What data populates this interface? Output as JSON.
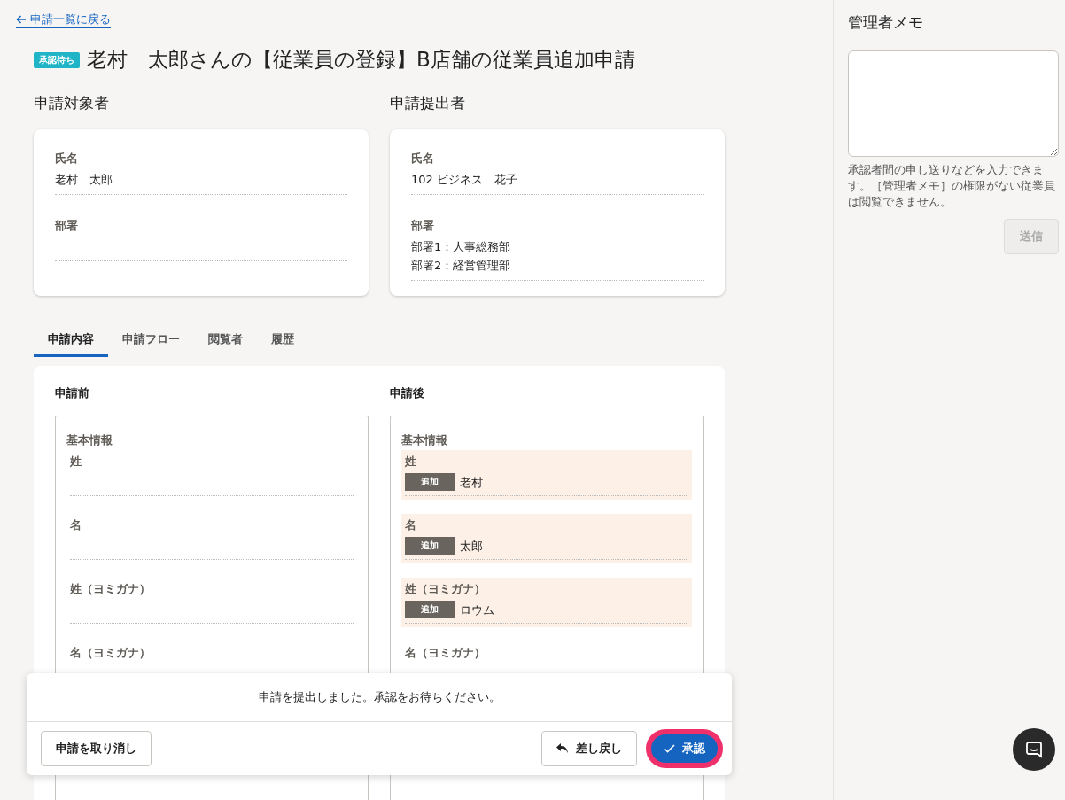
{
  "back_link": "申請一覧に戻る",
  "status_badge": "承認待ち",
  "title": "老村　太郎さんの【従業員の登録】B店舗の従業員追加申請",
  "people": [
    {
      "heading": "申請対象者",
      "fields": [
        {
          "label": "氏名",
          "lines": [
            "老村　太郎"
          ]
        },
        {
          "label": "部署"
        }
      ]
    },
    {
      "heading": "申請提出者",
      "fields": [
        {
          "label": "氏名",
          "lines": [
            "102 ビジネス　花子"
          ]
        },
        {
          "label": "部署",
          "lines": [
            "部署1：人事総務部",
            "部署2：経営管理部"
          ]
        }
      ]
    }
  ],
  "tabs": [
    {
      "label": "申請内容",
      "selected": true
    },
    {
      "label": "申請フロー",
      "selected": false
    },
    {
      "label": "閲覧者",
      "selected": false
    },
    {
      "label": "履歴",
      "selected": false
    }
  ],
  "content": {
    "before": {
      "heading": "申請前",
      "section": "基本情報",
      "fields": [
        {
          "label": "姓"
        },
        {
          "label": "名"
        },
        {
          "label": "姓（ヨミガナ）"
        },
        {
          "label": "名（ヨミガナ）"
        }
      ]
    },
    "after": {
      "heading": "申請後",
      "section": "基本情報",
      "fields": [
        {
          "label": "姓",
          "badge": "追加",
          "value": "老村"
        },
        {
          "label": "名",
          "badge": "追加",
          "value": "太郎"
        },
        {
          "label": "姓（ヨミガナ）",
          "badge": "追加",
          "value": "ロウム"
        },
        {
          "label": "名（ヨミガナ）"
        }
      ]
    }
  },
  "footer": {
    "message": "申請を提出しました。承認をお待ちください。",
    "cancel_button": "申請を取り消し",
    "return_button": "差し戻し",
    "approve_button": "承認",
    "approve_highlighted": true
  },
  "memo": {
    "title": "管理者メモ",
    "hint": "承認者間の申し送りなどを入力できます。［管理者メモ］の権限がない従業員は閲覧できません。",
    "send_button": "送信",
    "send_disabled": true
  }
}
